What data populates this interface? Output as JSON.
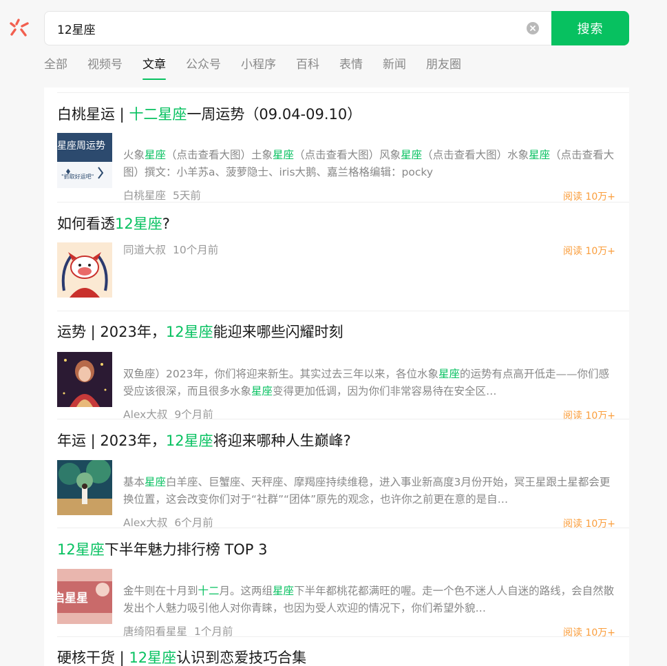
{
  "search": {
    "query": "12星座",
    "button_label": "搜索"
  },
  "tabs": [
    {
      "label": "全部"
    },
    {
      "label": "视频号"
    },
    {
      "label": "文章",
      "active": true
    },
    {
      "label": "公众号"
    },
    {
      "label": "小程序"
    },
    {
      "label": "百科"
    },
    {
      "label": "表情"
    },
    {
      "label": "新闻"
    },
    {
      "label": "朋友圈"
    }
  ],
  "results": [
    {
      "title_parts": [
        {
          "text": "白桃星运 | ",
          "hl": false
        },
        {
          "text": "十二星座",
          "hl": true
        },
        {
          "text": "一周运势（09.04-09.10）",
          "hl": false
        }
      ],
      "snippet_parts": [
        {
          "text": "火象",
          "hl": false
        },
        {
          "text": "星座",
          "hl": true
        },
        {
          "text": "（点击查看大图）土象",
          "hl": false
        },
        {
          "text": "星座",
          "hl": true
        },
        {
          "text": "（点击查看大图）风象",
          "hl": false
        },
        {
          "text": "星座",
          "hl": true
        },
        {
          "text": "（点击查看大图）水象",
          "hl": false
        },
        {
          "text": "星座",
          "hl": true
        },
        {
          "text": "（点击查看大图）撰文：小羊苏a、菠萝隐士、iris大鹅、嘉兰格格编辑：pocky",
          "hl": false
        }
      ],
      "source": "白桃星座",
      "time": "5天前",
      "reads": "阅读 10万+",
      "thumb_text": "星座周运势",
      "thumb_subtext": "\"抓取好运吧\""
    },
    {
      "title_parts": [
        {
          "text": "如何看透",
          "hl": false
        },
        {
          "text": "12星座",
          "hl": true
        },
        {
          "text": "?",
          "hl": false
        }
      ],
      "snippet_parts": [],
      "source": "同道大叔",
      "time": "10个月前",
      "reads": "阅读 10万+"
    },
    {
      "title_parts": [
        {
          "text": "运势 | 2023年，",
          "hl": false
        },
        {
          "text": "12星座",
          "hl": true
        },
        {
          "text": "能迎来哪些闪耀时刻",
          "hl": false
        }
      ],
      "snippet_parts": [
        {
          "text": "双鱼座）2023年，你们将迎来新生。其实过去三年以来，各位水象",
          "hl": false
        },
        {
          "text": "星座",
          "hl": true
        },
        {
          "text": "的运势有点高开低走——你们感受应该很深，而且很多水象",
          "hl": false
        },
        {
          "text": "星座",
          "hl": true
        },
        {
          "text": "变得更加低调，因为你们非常容易待在安全区…",
          "hl": false
        }
      ],
      "source": "Alex大叔",
      "time": "9个月前",
      "reads": "阅读 10万+"
    },
    {
      "title_parts": [
        {
          "text": "年运 | 2023年，",
          "hl": false
        },
        {
          "text": "12星座",
          "hl": true
        },
        {
          "text": "将迎来哪种人生巅峰?",
          "hl": false
        }
      ],
      "snippet_parts": [
        {
          "text": "基本",
          "hl": false
        },
        {
          "text": "星座",
          "hl": true
        },
        {
          "text": "白羊座、巨蟹座、天秤座、摩羯座持续维稳，进入事业新高度3月份开始，冥王星跟土星都会更换位置，这会改变你们对于“社群”“团体”原先的观念，也许你之前更在意的是自…",
          "hl": false
        }
      ],
      "source": "Alex大叔",
      "time": "6个月前",
      "reads": "阅读 10万+"
    },
    {
      "title_parts": [
        {
          "text": "12星座",
          "hl": true
        },
        {
          "text": "下半年魅力排行榜 TOP 3",
          "hl": false
        }
      ],
      "snippet_parts": [
        {
          "text": "金牛则在十月到",
          "hl": false
        },
        {
          "text": "十二",
          "hl": true
        },
        {
          "text": "月。这两组",
          "hl": false
        },
        {
          "text": "星座",
          "hl": true
        },
        {
          "text": "下半年都桃花都满旺的喔。走一个色不迷人人自迷的路线，会自然散发出个人魅力吸引他人对你青睐，也因为受人欢迎的情况下，你们希望外貌…",
          "hl": false
        }
      ],
      "source": "唐绮阳看星星",
      "time": "1个月前",
      "reads": "阅读 10万+",
      "thumb_text": "启星星"
    },
    {
      "title_parts": [
        {
          "text": "硬核干货 | ",
          "hl": false
        },
        {
          "text": "12星座",
          "hl": true
        },
        {
          "text": "认识到恋爱技巧合集",
          "hl": false
        }
      ]
    }
  ]
}
